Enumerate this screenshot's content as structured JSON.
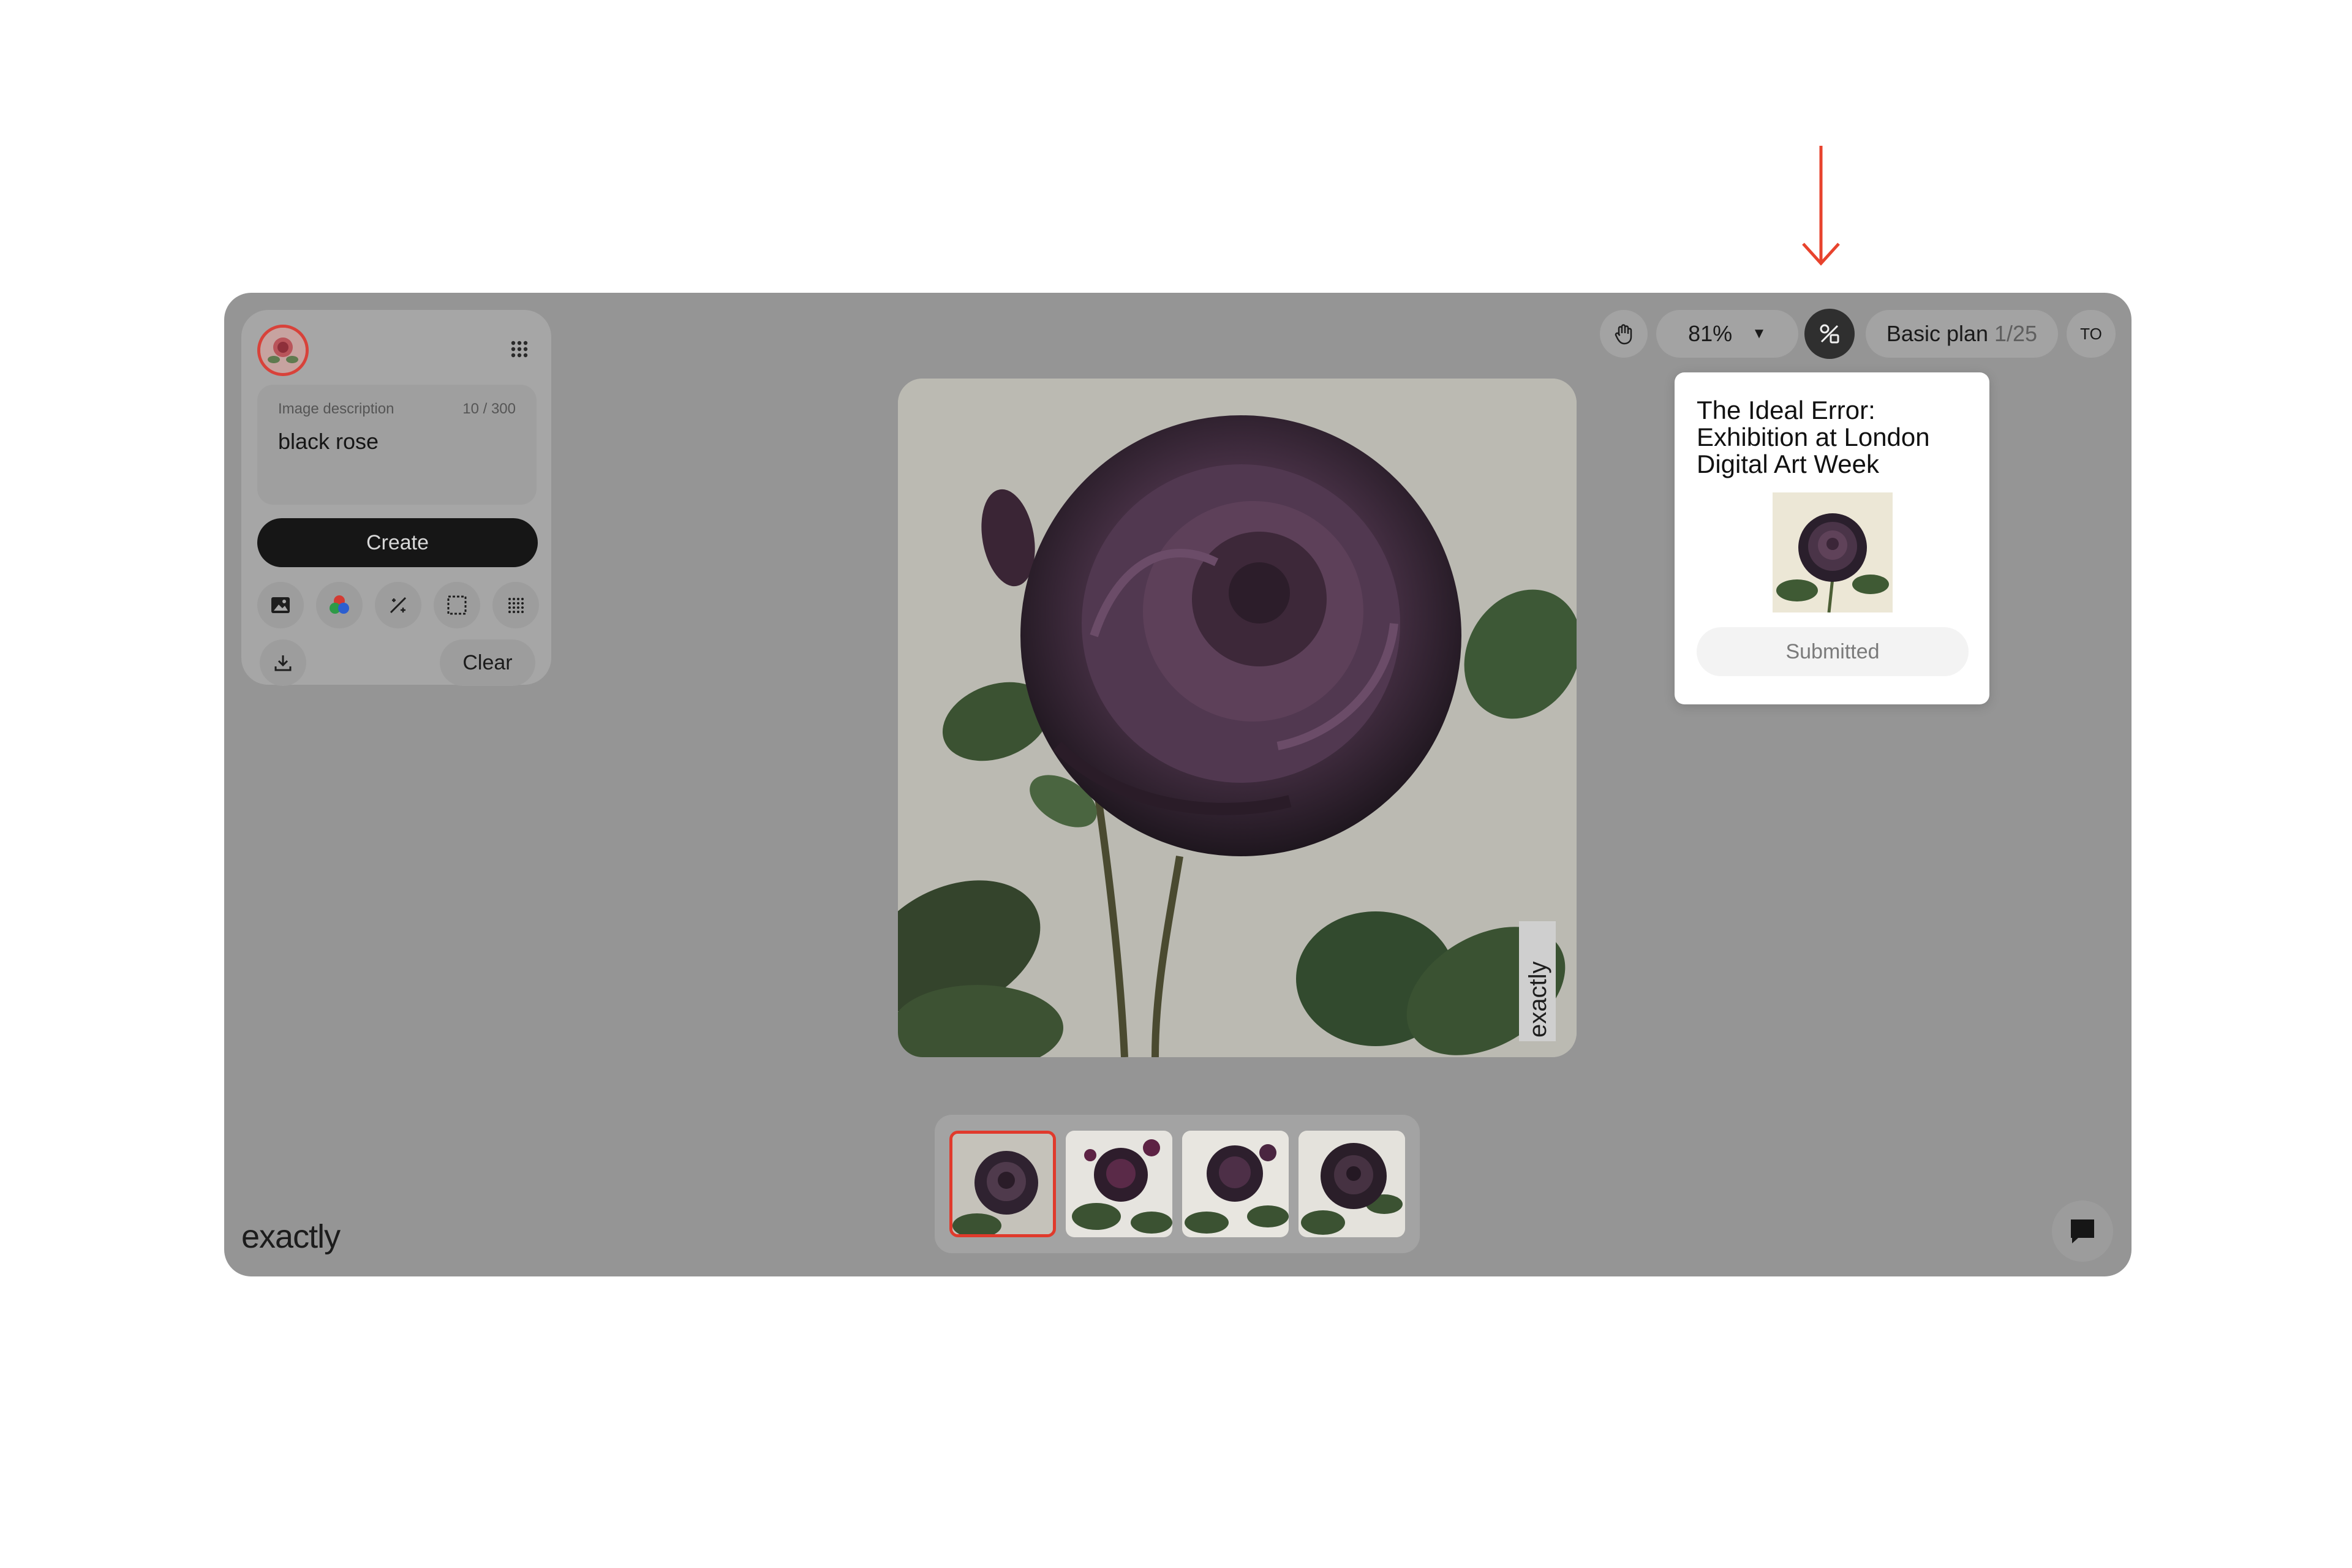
{
  "annotation": {
    "arrow_color": "#e8432d"
  },
  "panel": {
    "description": {
      "label": "Image description",
      "count": "10 / 300",
      "value": "black rose"
    },
    "create_label": "Create",
    "tools": [
      "image-icon",
      "color-palette-icon",
      "magic-wand-icon",
      "selection-icon",
      "pattern-grid-icon"
    ],
    "download_icon": "download-icon",
    "clear_label": "Clear"
  },
  "brand": "exactly",
  "topbar": {
    "zoom": "81%",
    "plan_label": "Basic plan",
    "plan_count": "1/25",
    "user_initials": "TO"
  },
  "popover": {
    "title": "The Ideal Error: Exhibition at London Digital Art Week",
    "status": "Submitted"
  },
  "canvas": {
    "watermark": "exactly"
  },
  "thumbnails": {
    "count": 4,
    "selected_index": 0,
    "selected_color": "#e03a2c"
  }
}
